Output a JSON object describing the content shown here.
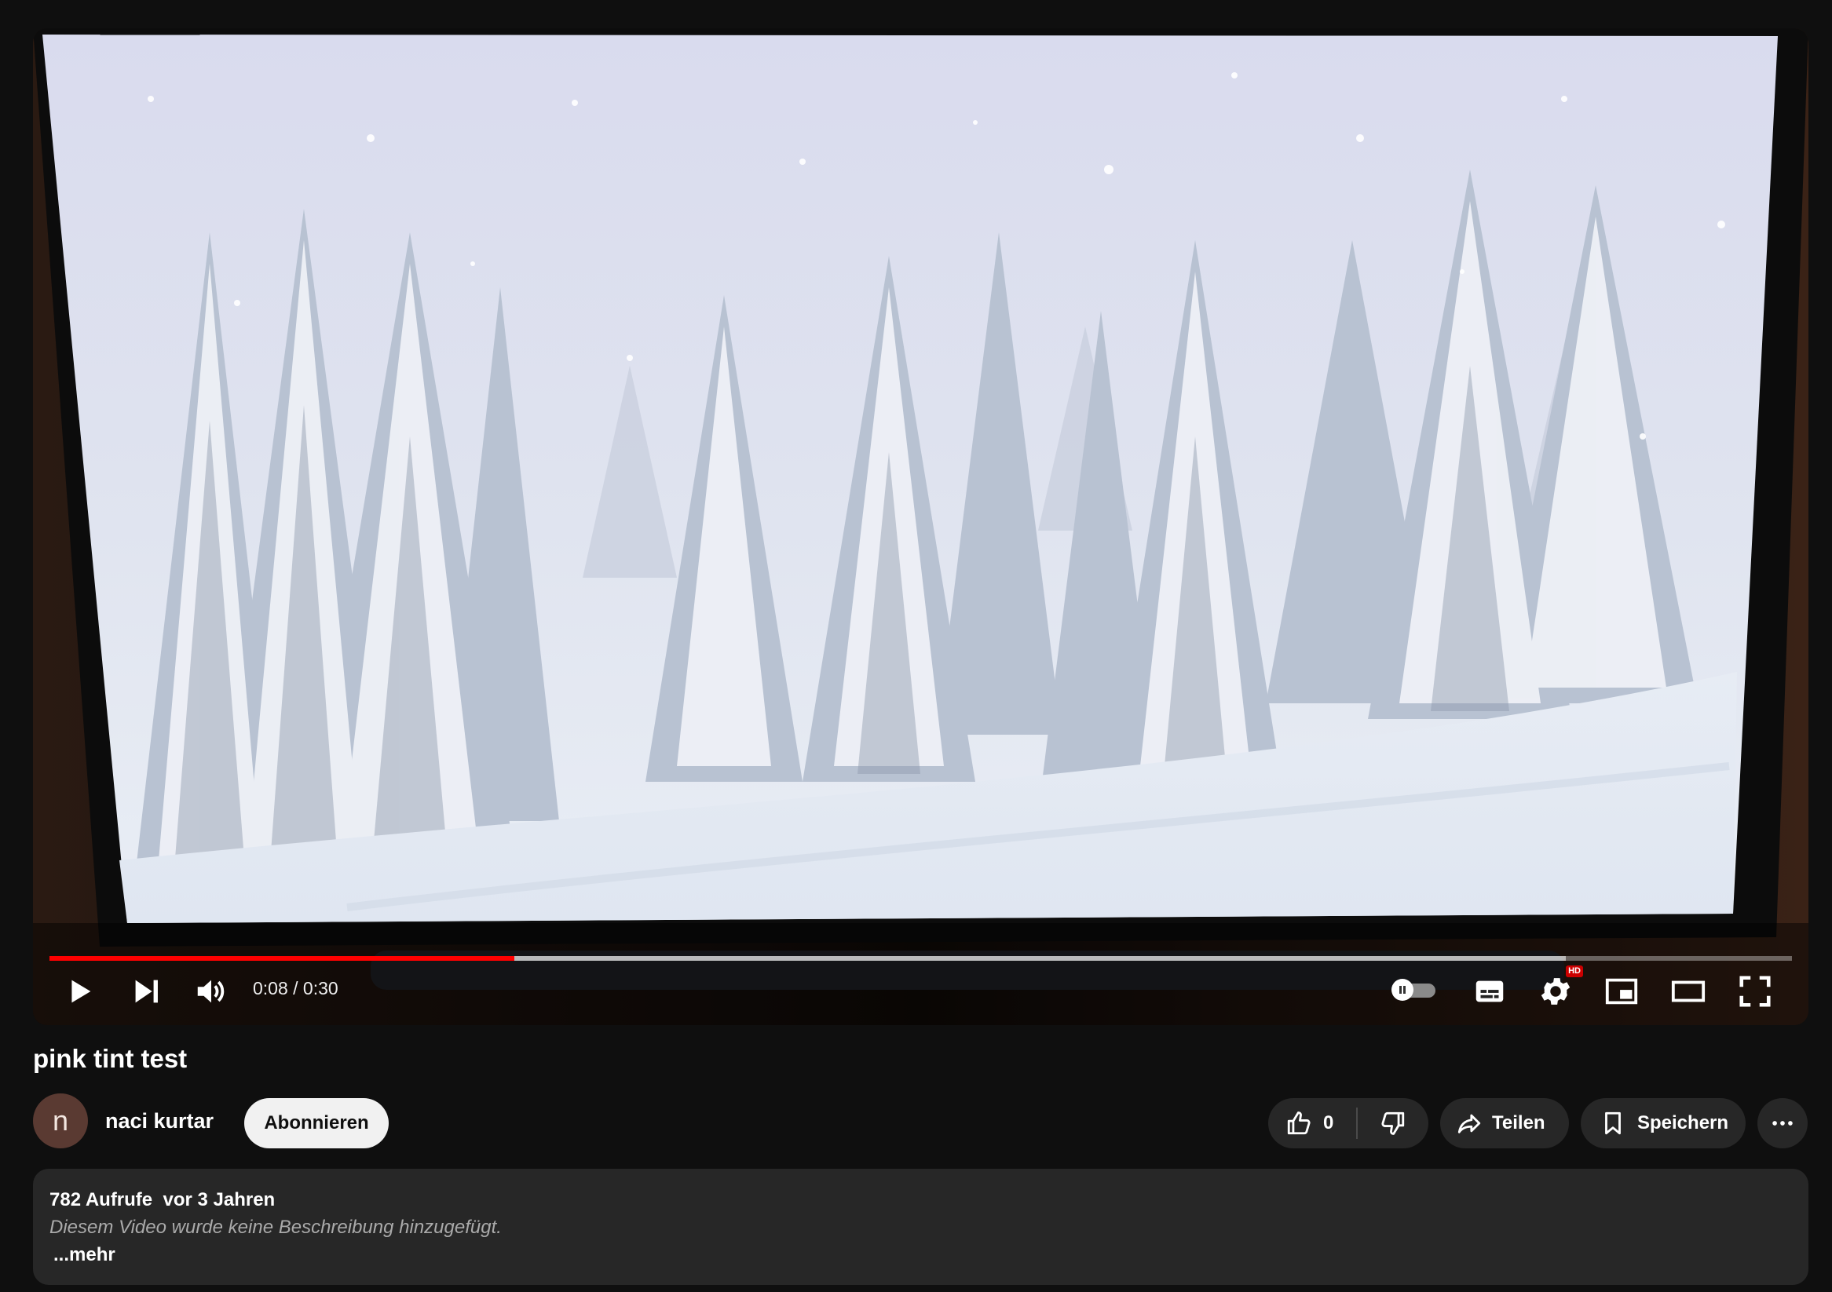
{
  "player": {
    "progress_fraction": 0.267,
    "buffered_fraction": 0.87,
    "time_display": "0:08 / 0:30",
    "hd_badge": "HD",
    "accent_color": "#ff0000"
  },
  "video": {
    "title": "pink tint test"
  },
  "channel": {
    "avatar_letter": "n",
    "name": "naci kurtar",
    "subscribe_label": "Abonnieren"
  },
  "actions": {
    "like_count": "0",
    "share_label": "Teilen",
    "save_label": "Speichern"
  },
  "description": {
    "meta": "782 Aufrufe  vor 3 Jahren",
    "text": "Diesem Video wurde keine Beschreibung hinzugefügt.",
    "more_label": "...mehr"
  },
  "icons": [
    "play-icon",
    "next-icon",
    "volume-icon",
    "autoplay-toggle",
    "subtitles-icon",
    "settings-icon",
    "miniplayer-icon",
    "theater-icon",
    "fullscreen-icon",
    "like-icon",
    "dislike-icon",
    "share-icon",
    "save-icon",
    "more-icon"
  ]
}
